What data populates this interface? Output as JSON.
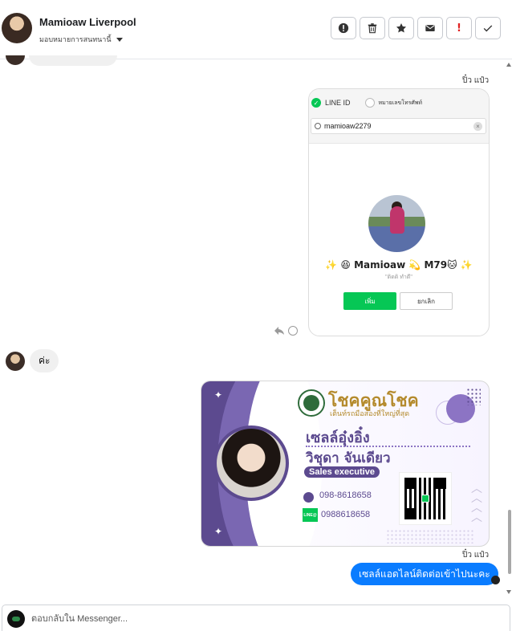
{
  "header": {
    "contact_name": "Mamioaw Liverpool",
    "assign_label": "มอบหมายการสนทนานี้"
  },
  "actions": [
    {
      "name": "report-button",
      "icon": "exclamation-circle-icon"
    },
    {
      "name": "delete-button",
      "icon": "trash-icon"
    },
    {
      "name": "star-button",
      "icon": "star-icon"
    },
    {
      "name": "unread-button",
      "icon": "envelope-icon"
    },
    {
      "name": "important-button",
      "icon": "exclamation-icon",
      "text": "!"
    },
    {
      "name": "done-button",
      "icon": "check-icon"
    }
  ],
  "messages": {
    "sender_label_1": "ปิ๋ว แป๋ว",
    "line_card": {
      "option_line_id": "LINE ID",
      "option_phone": "หมายเลขโทรศัพท์",
      "search_value": "mamioaw2279",
      "profile_name": "✨ 😆 Mamioaw 💫 M79🐱 ✨",
      "profile_sub": "\"ติดดิ ทำดี\"",
      "add_label": "เพิ่ม",
      "cancel_label": "ยกเลิก"
    },
    "incoming_text": "ค่ะ",
    "biz_card": {
      "brand": "โชคคูณโชค",
      "tagline": "เต็นท์รถมือสองที่ใหญ่ที่สุด",
      "nickname": "เซลล์อุ๋งอิ๋ง",
      "full_name": "วิชุดา จันเดียว",
      "role": "Sales executive",
      "phone": "098-8618658",
      "line_badge": "LINE@",
      "line_id": "0988618658"
    },
    "sender_label_2": "ปิ๋ว แป๋ว",
    "outgoing_text": "เซลล์แอดไลน์ติดต่อเข้าไปนะคะ"
  },
  "composer": {
    "placeholder": "ตอบกลับใน Messenger..."
  },
  "colors": {
    "messenger_blue": "#0a7cff",
    "line_green": "#06c755",
    "card_purple": "#5c4a8f",
    "brand_gold": "#b48a2c"
  }
}
